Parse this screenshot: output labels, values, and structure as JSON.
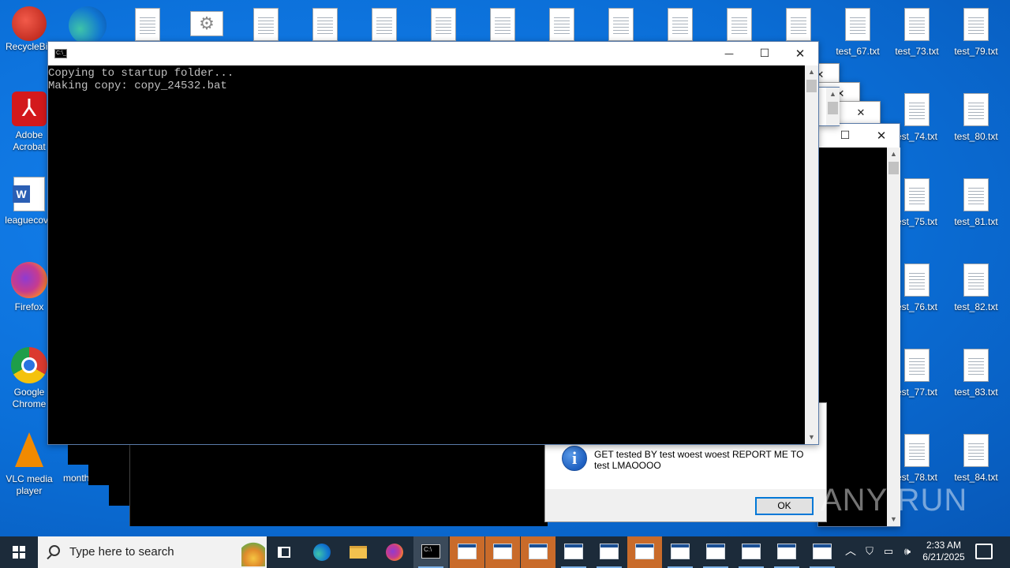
{
  "desktop": {
    "left_icons": [
      {
        "label": "RecycleBin"
      },
      {
        "label": "Adobe Acrobat"
      },
      {
        "label": "leaguecove"
      },
      {
        "label": "Firefox"
      },
      {
        "label": "Google Chrome"
      },
      {
        "label": "VLC media player"
      }
    ],
    "right_files": [
      {
        "label": "test_67.txt"
      },
      {
        "label": "test_73.txt"
      },
      {
        "label": "test_79.txt"
      },
      {
        "label": "est_74.txt"
      },
      {
        "label": "test_80.txt"
      },
      {
        "label": "est_75.txt"
      },
      {
        "label": "test_81.txt"
      },
      {
        "label": "est_76.txt"
      },
      {
        "label": "test_82.txt"
      },
      {
        "label": "est_77.txt"
      },
      {
        "label": "test_83.txt"
      },
      {
        "label": "est_78.txt"
      },
      {
        "label": "test_84.txt"
      }
    ],
    "partial_label_month": "month"
  },
  "cmd_window": {
    "icon": "cmd-icon",
    "lines": [
      "Copying to startup folder...",
      "Making copy: copy_24532.bat"
    ],
    "minimize": "—",
    "maximize": "☐",
    "close": "✕"
  },
  "message_box": {
    "text": "GET tested BY test woest woest REPORT ME TO test LMAOOOO",
    "ok_label": "OK",
    "icon": "info-icon",
    "icon_glyph": "i"
  },
  "taskbar": {
    "search_placeholder": "Type here to search",
    "time": "2:33 AM",
    "date": "6/21/2025"
  },
  "watermark": "ANY RUN"
}
